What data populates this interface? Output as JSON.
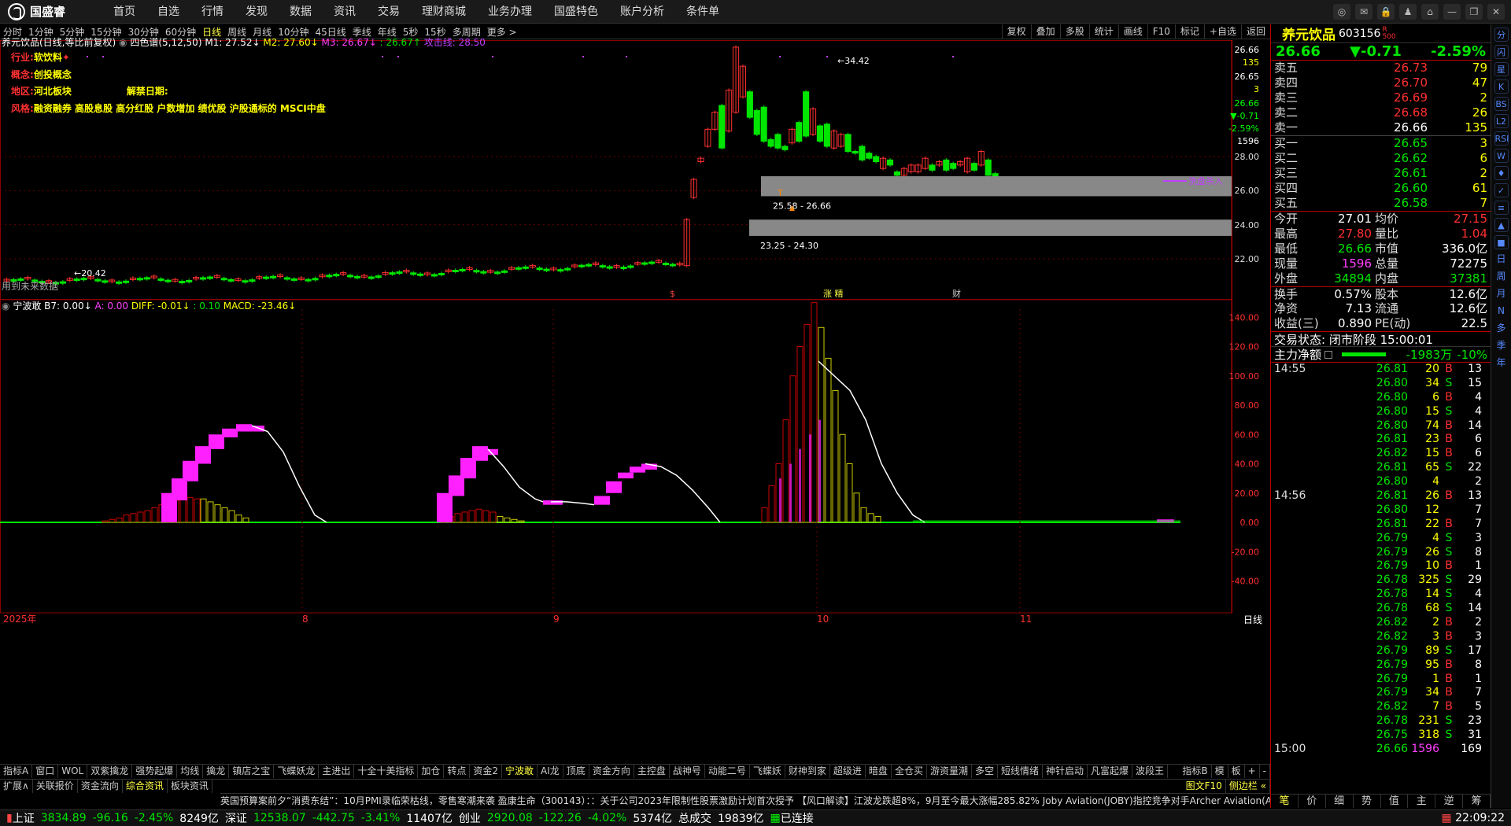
{
  "app": {
    "logo": "国盛睿"
  },
  "menu": [
    "首页",
    "自选",
    "行情",
    "发现",
    "数据",
    "资讯",
    "交易",
    "理财商城",
    "业务办理",
    "国盛特色",
    "账户分析",
    "条件单"
  ],
  "window_buttons": [
    "chat-icon",
    "message-icon",
    "lock-icon",
    "shirt-icon",
    "skin-icon",
    "minimize-icon",
    "restore-icon",
    "close-icon"
  ],
  "toolbar": {
    "periods": [
      "分时",
      "1分钟",
      "5分钟",
      "15分钟",
      "30分钟",
      "60分钟",
      "日线",
      "周线",
      "月线",
      "10分钟",
      "45日线",
      "季线",
      "年线",
      "5秒",
      "15秒",
      "多周期",
      "更多 >"
    ],
    "active": "日线",
    "right": [
      "复权",
      "叠加",
      "多股",
      "统计",
      "画线",
      "F10",
      "标记",
      "+自选",
      "返回"
    ]
  },
  "main_chart": {
    "title": "养元饮品(日线,等比前复权)",
    "indicator": "四色谱(5,12,50)",
    "m1": "M1: 27.52↓",
    "m2": "M2: 27.60↓",
    "m3": "M3: 26.67↓",
    "blank": ": 26.67↑",
    "attack": "攻击线: 28.50",
    "info": {
      "industry_label": "行业:",
      "industry": "软饮料",
      "concept_label": "概念:",
      "concept": "创投概念",
      "region_label": "地区:",
      "region": "河北板块",
      "unlock_label": "解禁日期:",
      "style_label": "风格:",
      "style": "融资融券 高股息股 高分红股 户数增加 绩优股 沪股通标的 MSCI中盘"
    },
    "footer_left": "用到未来数据",
    "price_labels": {
      "high": "34.42",
      "low": "20.42",
      "gap1": "25.58 - 26.66",
      "gap2": "23.25 - 24.30",
      "signal": "洗盘杀入"
    },
    "event_markers": [
      "$",
      "涨 精",
      "财"
    ],
    "yaxis": [
      "26.66",
      "135",
      "26.65",
      "3",
      "26.66",
      "▼-0.71",
      "-2.59%",
      "1596",
      "28.00",
      "26.00",
      "24.00",
      "22.00"
    ]
  },
  "sub_chart": {
    "title": "宁波敢",
    "b7": "B7: 0.00↓",
    "a": "A: 0.00",
    "diff": "DIFF: -0.01↓",
    "blank": ": 0.10",
    "macd": "MACD: -23.46↓",
    "yaxis": [
      "140.00",
      "120.00",
      "100.00",
      "80.00",
      "60.00",
      "40.00",
      "20.00",
      "0.00",
      "-20.00",
      "-40.00"
    ],
    "xaxis": [
      "2025年",
      "8",
      "9",
      "10",
      "11"
    ],
    "period": "日线"
  },
  "bottom_tabs": [
    "指标A",
    "窗口",
    "WOL",
    "双紫擒龙",
    "强势起爆",
    "均线",
    "擒龙",
    "镇店之宝",
    "飞蝶妖龙",
    "主进出",
    "十全十美指标",
    "加仓",
    "转点",
    "资金2",
    "宁波敢",
    "AI龙",
    "顶底",
    "资金方向",
    "主控盘",
    "战神号",
    "动能二号",
    "飞蝶妖",
    "财神到家",
    "超级进",
    "暗盘",
    "全仓买",
    "游资量潮",
    "多空",
    "短线情绪",
    "神针启动",
    "凡富起爆",
    "波段王"
  ],
  "bottom_tabs_active": "宁波敢",
  "bottom_tabs_right": [
    "指标B",
    "模",
    "板",
    "+",
    "-"
  ],
  "bottom_tabs2": [
    "扩展∧",
    "关联报价",
    "资金流向",
    "综合资讯",
    "板块资讯"
  ],
  "bottom_tabs2_active": "综合资讯",
  "bottom_tabs2_right": [
    "图文F10",
    "侧边栏 «"
  ],
  "ticker": "英国预算案前夕“消费东结”：10月PMI录临荣枯线，零售寒潮来袭        盈康生命（300143）：：关于公司2023年限制性股票激励计划首次授予        【风口解读】江波龙跌超8%，9月至今最大涨幅285.82%        Joby Aviation(JOBY)指控竞争对手Archer Aviation(ACHR)商业窃密        中国黄金（600916）：2025-048：中国黄金关于控股股东增持",
  "quote": {
    "name": "养元饮品",
    "code": "603156",
    "tag": "R",
    "tag2": "500",
    "price": "26.66",
    "change": "▼-0.71",
    "pct": "-2.59%",
    "sells": [
      [
        "卖五",
        "26.73",
        "79"
      ],
      [
        "卖四",
        "26.70",
        "47"
      ],
      [
        "卖三",
        "26.69",
        "2"
      ],
      [
        "卖二",
        "26.68",
        "26"
      ],
      [
        "卖一",
        "26.66",
        "135"
      ]
    ],
    "buys": [
      [
        "买一",
        "26.65",
        "3"
      ],
      [
        "买二",
        "26.62",
        "6"
      ],
      [
        "买三",
        "26.61",
        "2"
      ],
      [
        "买四",
        "26.60",
        "61"
      ],
      [
        "买五",
        "26.58",
        "7"
      ]
    ],
    "stats": [
      [
        "今开",
        "27.01",
        "均价",
        "27.15"
      ],
      [
        "最高",
        "27.80",
        "量比",
        "1.04"
      ],
      [
        "最低",
        "26.66",
        "市值",
        "336.0亿"
      ],
      [
        "现量",
        "1596",
        "总量",
        "72275"
      ],
      [
        "外盘",
        "34894",
        "内盘",
        "37381"
      ],
      [
        "换手",
        "0.57%",
        "股本",
        "12.6亿"
      ],
      [
        "净资",
        "7.13",
        "流通",
        "12.6亿"
      ],
      [
        "收益(三)",
        "0.890",
        "PE(动)",
        "22.5"
      ]
    ],
    "trade_state": "交易状态: 闭市阶段 15:00:01",
    "main_flow_label": "主力净额",
    "main_flow": "-1983万",
    "main_flow_pct": "-10%"
  },
  "ticks": [
    [
      "14:55",
      "26.81",
      "20",
      "B",
      "13"
    ],
    [
      "",
      "26.80",
      "34",
      "S",
      "15"
    ],
    [
      "",
      "26.80",
      "6",
      "B",
      "4"
    ],
    [
      "",
      "26.80",
      "15",
      "S",
      "4"
    ],
    [
      "",
      "26.80",
      "74",
      "B",
      "14"
    ],
    [
      "",
      "26.81",
      "23",
      "B",
      "6"
    ],
    [
      "",
      "26.82",
      "15",
      "B",
      "6"
    ],
    [
      "",
      "26.81",
      "65",
      "S",
      "22"
    ],
    [
      "",
      "26.80",
      "4",
      "",
      "2"
    ],
    [
      "14:56",
      "26.81",
      "26",
      "B",
      "13"
    ],
    [
      "",
      "26.80",
      "12",
      "",
      "7"
    ],
    [
      "",
      "26.81",
      "22",
      "B",
      "7"
    ],
    [
      "",
      "26.79",
      "4",
      "S",
      "3"
    ],
    [
      "",
      "26.79",
      "26",
      "S",
      "8"
    ],
    [
      "",
      "26.79",
      "10",
      "B",
      "1"
    ],
    [
      "",
      "26.78",
      "325",
      "S",
      "29"
    ],
    [
      "",
      "26.78",
      "14",
      "S",
      "4"
    ],
    [
      "",
      "26.78",
      "68",
      "S",
      "14"
    ],
    [
      "",
      "26.82",
      "2",
      "B",
      "2"
    ],
    [
      "",
      "26.82",
      "3",
      "B",
      "3"
    ],
    [
      "",
      "26.79",
      "89",
      "S",
      "17"
    ],
    [
      "",
      "26.79",
      "95",
      "B",
      "8"
    ],
    [
      "",
      "26.79",
      "1",
      "B",
      "1"
    ],
    [
      "",
      "26.79",
      "34",
      "B",
      "7"
    ],
    [
      "",
      "26.82",
      "7",
      "B",
      "5"
    ],
    [
      "",
      "26.78",
      "231",
      "S",
      "23"
    ],
    [
      "",
      "26.75",
      "318",
      "S",
      "31"
    ],
    [
      "15:00",
      "26.66",
      "1596",
      "",
      "169"
    ]
  ],
  "tick_tabs": [
    "笔",
    "价",
    "细",
    "势",
    "值",
    "主",
    "逆",
    "筹"
  ],
  "side_icons": [
    "分",
    "闪",
    "星",
    "K",
    "BS",
    "L2",
    "RSI",
    "W",
    "♦",
    "✓",
    "≡",
    "▲",
    "■"
  ],
  "side_text": [
    "日",
    "周",
    "月",
    "N",
    "多",
    "季",
    "年"
  ],
  "statusbar": {
    "sh_label": "上证",
    "sh": "3834.89",
    "sh_chg": "-96.16",
    "sh_pct": "-2.45%",
    "sh_amt": "8249亿",
    "sz_label": "深证",
    "sz": "12538.07",
    "sz_chg": "-442.75",
    "sz_pct": "-3.41%",
    "sz_amt": "11407亿",
    "cy_label": "创业",
    "cy": "2920.08",
    "cy_chg": "-122.26",
    "cy_pct": "-4.02%",
    "cy_amt": "5374亿",
    "total_label": "总成交",
    "total": "19839亿",
    "conn": "已连接",
    "time": "22:09:22"
  },
  "colors": {
    "up": "#ff3030",
    "down": "#00e600",
    "flat": "#ffff00",
    "bg": "#000000",
    "grid": "#8b0000"
  }
}
